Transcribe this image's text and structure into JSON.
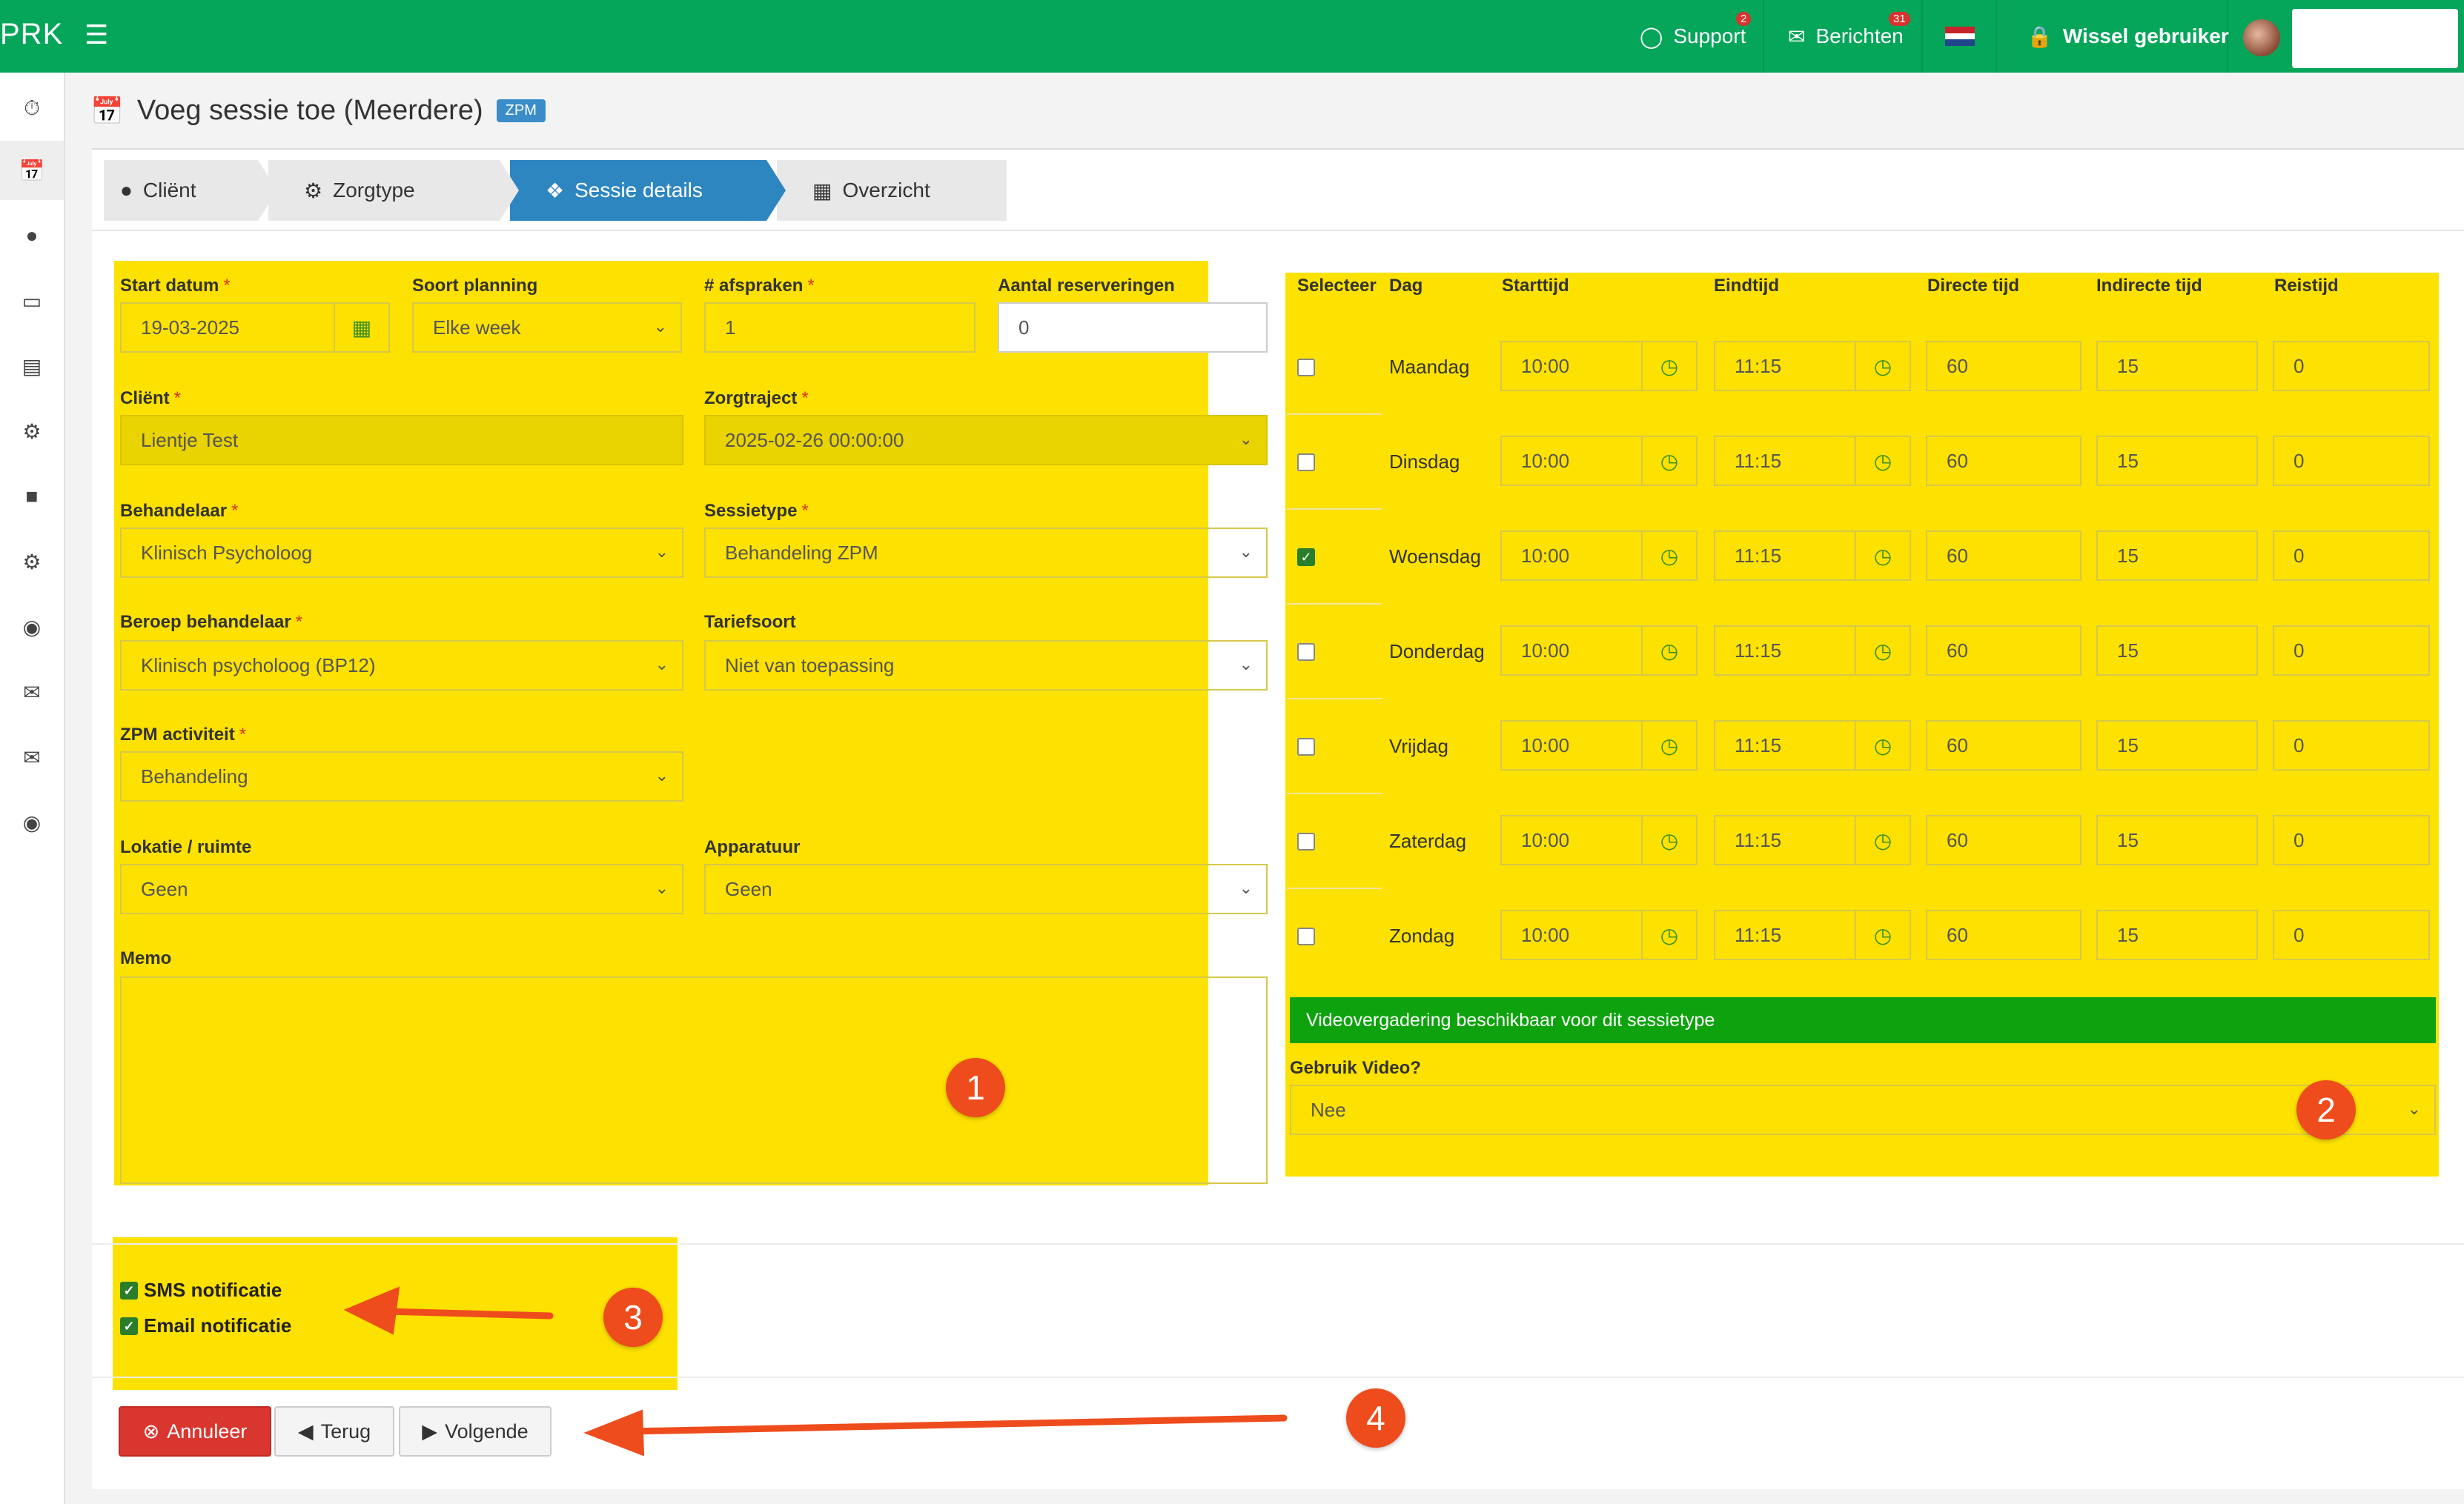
{
  "topbar": {
    "logo": "PRK",
    "support_label": "Support",
    "support_badge": "2",
    "messages_label": "Berichten",
    "messages_badge": "31",
    "switch_user_label": "Wissel gebruiker"
  },
  "page": {
    "title": "Voeg sessie toe (Meerdere)",
    "tag": "ZPM"
  },
  "steps": [
    {
      "label": "Cliënt",
      "icon": "user-icon"
    },
    {
      "label": "Zorgtype",
      "icon": "gear-icon"
    },
    {
      "label": "Sessie details",
      "icon": "puzzle-icon",
      "active": true
    },
    {
      "label": "Overzicht",
      "icon": "table-icon"
    }
  ],
  "form": {
    "start_date": {
      "label": "Start datum",
      "value": "19-03-2025"
    },
    "planning": {
      "label": "Soort planning",
      "value": "Elke week"
    },
    "appointments": {
      "label": "# afspraken",
      "value": "1"
    },
    "reservations": {
      "label": "Aantal reserveringen",
      "value": "0"
    },
    "client": {
      "label": "Cliënt",
      "value": "Lientje Test"
    },
    "care_track": {
      "label": "Zorgtraject",
      "value": "2025-02-26 00:00:00"
    },
    "practitioner": {
      "label": "Behandelaar",
      "value": "Klinisch Psycholoog"
    },
    "session_type": {
      "label": "Sessietype",
      "value": "Behandeling ZPM"
    },
    "profession": {
      "label": "Beroep behandelaar",
      "value": "Klinisch psycholoog (BP12)"
    },
    "tariff": {
      "label": "Tariefsoort",
      "value": "Niet van toepassing"
    },
    "zpm_activity": {
      "label": "ZPM activiteit",
      "value": "Behandeling"
    },
    "location": {
      "label": "Lokatie / ruimte",
      "value": "Geen"
    },
    "equipment": {
      "label": "Apparatuur",
      "value": "Geen"
    },
    "memo": {
      "label": "Memo",
      "value": ""
    }
  },
  "schedule": {
    "headers": [
      "Selecteer",
      "Dag",
      "Starttijd",
      "Eindtijd",
      "Directe tijd",
      "Indirecte tijd",
      "Reistijd"
    ],
    "rows": [
      {
        "day": "Maandag",
        "selected": false,
        "start": "10:00",
        "end": "11:15",
        "direct": "60",
        "indirect": "15",
        "travel": "0"
      },
      {
        "day": "Dinsdag",
        "selected": false,
        "start": "10:00",
        "end": "11:15",
        "direct": "60",
        "indirect": "15",
        "travel": "0"
      },
      {
        "day": "Woensdag",
        "selected": true,
        "start": "10:00",
        "end": "11:15",
        "direct": "60",
        "indirect": "15",
        "travel": "0"
      },
      {
        "day": "Donderdag",
        "selected": false,
        "start": "10:00",
        "end": "11:15",
        "direct": "60",
        "indirect": "15",
        "travel": "0"
      },
      {
        "day": "Vrijdag",
        "selected": false,
        "start": "10:00",
        "end": "11:15",
        "direct": "60",
        "indirect": "15",
        "travel": "0"
      },
      {
        "day": "Zaterdag",
        "selected": false,
        "start": "10:00",
        "end": "11:15",
        "direct": "60",
        "indirect": "15",
        "travel": "0"
      },
      {
        "day": "Zondag",
        "selected": false,
        "start": "10:00",
        "end": "11:15",
        "direct": "60",
        "indirect": "15",
        "travel": "0"
      }
    ],
    "video_notice": "Videovergadering beschikbaar voor dit sessietype",
    "video_label": "Gebruik Video?",
    "video_value": "Nee"
  },
  "notifications": {
    "sms": {
      "label": "SMS notificatie",
      "checked": true
    },
    "email": {
      "label": "Email notificatie",
      "checked": true
    }
  },
  "buttons": {
    "cancel": "Annuleer",
    "back": "Terug",
    "next": "Volgende"
  },
  "callouts": [
    "1",
    "2",
    "3",
    "4"
  ],
  "colors": {
    "topbar": "#05a55a",
    "highlight": "#fde100",
    "active_step": "#2e86c1",
    "cancel_button": "#d9362f",
    "callout": "#ee4c1c",
    "video_notice": "#0ea30e"
  }
}
